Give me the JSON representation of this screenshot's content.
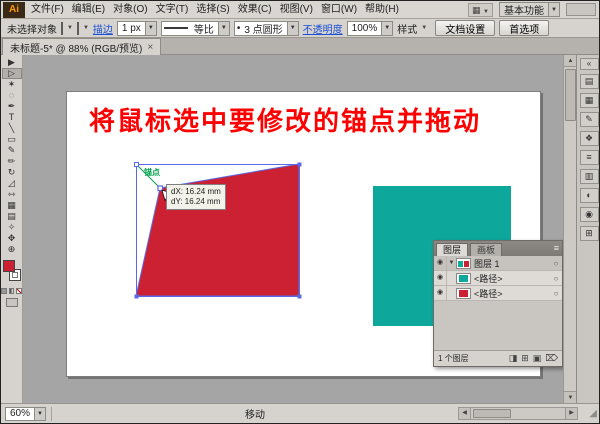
{
  "app": {
    "logo_text": "Ai",
    "menus": [
      "文件(F)",
      "编辑(E)",
      "对象(O)",
      "文字(T)",
      "选择(S)",
      "效果(C)",
      "视图(V)",
      "窗口(W)",
      "帮助(H)"
    ],
    "workspace_switcher": "基本功能"
  },
  "control_bar": {
    "no_selection": "未选择对象",
    "stroke_label": "描边",
    "stroke_weight": "1 px",
    "profile_value": "等比",
    "brush_value": "3 点圆形",
    "opacity_label": "不透明度",
    "opacity_value": "100%",
    "style_label": "样式",
    "doc_setup_button": "文档设置",
    "preferences_button": "首选项"
  },
  "document_tab": {
    "title": "未标题-5* @ 88% (RGB/预览)"
  },
  "toolbox": {
    "selected_index": 1,
    "tools": [
      {
        "name": "selection-tool",
        "glyph": "▶"
      },
      {
        "name": "direct-selection-tool",
        "glyph": "▷"
      },
      {
        "name": "magic-wand-tool",
        "glyph": "✶"
      },
      {
        "name": "lasso-tool",
        "glyph": "◌"
      },
      {
        "name": "pen-tool",
        "glyph": "✒"
      },
      {
        "name": "type-tool",
        "glyph": "T"
      },
      {
        "name": "line-tool",
        "glyph": "╲"
      },
      {
        "name": "rectangle-tool",
        "glyph": "▭"
      },
      {
        "name": "paintbrush-tool",
        "glyph": "✎"
      },
      {
        "name": "pencil-tool",
        "glyph": "✏"
      },
      {
        "name": "rotate-tool",
        "glyph": "↻"
      },
      {
        "name": "scale-tool",
        "glyph": "◿"
      },
      {
        "name": "width-tool",
        "glyph": "⇿"
      },
      {
        "name": "free-transform-tool",
        "glyph": "▦"
      },
      {
        "name": "gradient-tool",
        "glyph": "▤"
      },
      {
        "name": "eyedropper-tool",
        "glyph": "✧"
      },
      {
        "name": "hand-tool",
        "glyph": "✥"
      },
      {
        "name": "zoom-tool",
        "glyph": "⊕"
      }
    ]
  },
  "canvas": {
    "instruction_text": "将鼠标选中要修改的锚点并拖动",
    "anchor_label": "锚点",
    "tooltip_dx": "dX: 16.24 mm",
    "tooltip_dy": "dY: 16.24 mm"
  },
  "colors": {
    "red_shape": "#cb2133",
    "teal_shape": "#0da79c",
    "selection_blue": "#5a6ae6",
    "guide_green": "#00a14b",
    "instruction_red": "#fe0000"
  },
  "layers_panel": {
    "tabs": [
      "图层",
      "画板"
    ],
    "rows": [
      {
        "label": "图层 1",
        "expanded": true,
        "thumb": "mixed"
      },
      {
        "label": "<路径>",
        "expanded": false,
        "thumb": "teal"
      },
      {
        "label": "<路径>",
        "expanded": false,
        "thumb": "red"
      }
    ],
    "status": "1 个图层",
    "footer_icons": [
      {
        "name": "make-clipping-mask-icon",
        "glyph": "◨"
      },
      {
        "name": "new-sublayer-icon",
        "glyph": "⊞"
      },
      {
        "name": "new-layer-icon",
        "glyph": "▣"
      },
      {
        "name": "delete-layer-icon",
        "glyph": "⌦"
      }
    ]
  },
  "dock": {
    "expand_glyph": "«",
    "icons": [
      {
        "name": "color-panel-icon",
        "glyph": "▤"
      },
      {
        "name": "swatches-panel-icon",
        "glyph": "▦"
      },
      {
        "name": "brushes-panel-icon",
        "glyph": "✎"
      },
      {
        "name": "symbols-panel-icon",
        "glyph": "❖"
      },
      {
        "name": "stroke-panel-icon",
        "glyph": "≡"
      },
      {
        "name": "gradient-panel-icon",
        "glyph": "▥"
      },
      {
        "name": "transparency-panel-icon",
        "glyph": "◐"
      },
      {
        "name": "appearance-panel-icon",
        "glyph": "◉"
      },
      {
        "name": "graphic-styles-panel-icon",
        "glyph": "⊞"
      }
    ]
  },
  "status_bar": {
    "zoom": "60%",
    "tool_status": "移动"
  },
  "glyphs": {
    "dropdown": "▼",
    "up": "▲",
    "down": "▼",
    "left": "◀",
    "right": "▶",
    "eye": "◉",
    "target": "○",
    "menu": "≡",
    "close": "×",
    "grip": "◢",
    "bullet": "•",
    "expand": "▼"
  }
}
